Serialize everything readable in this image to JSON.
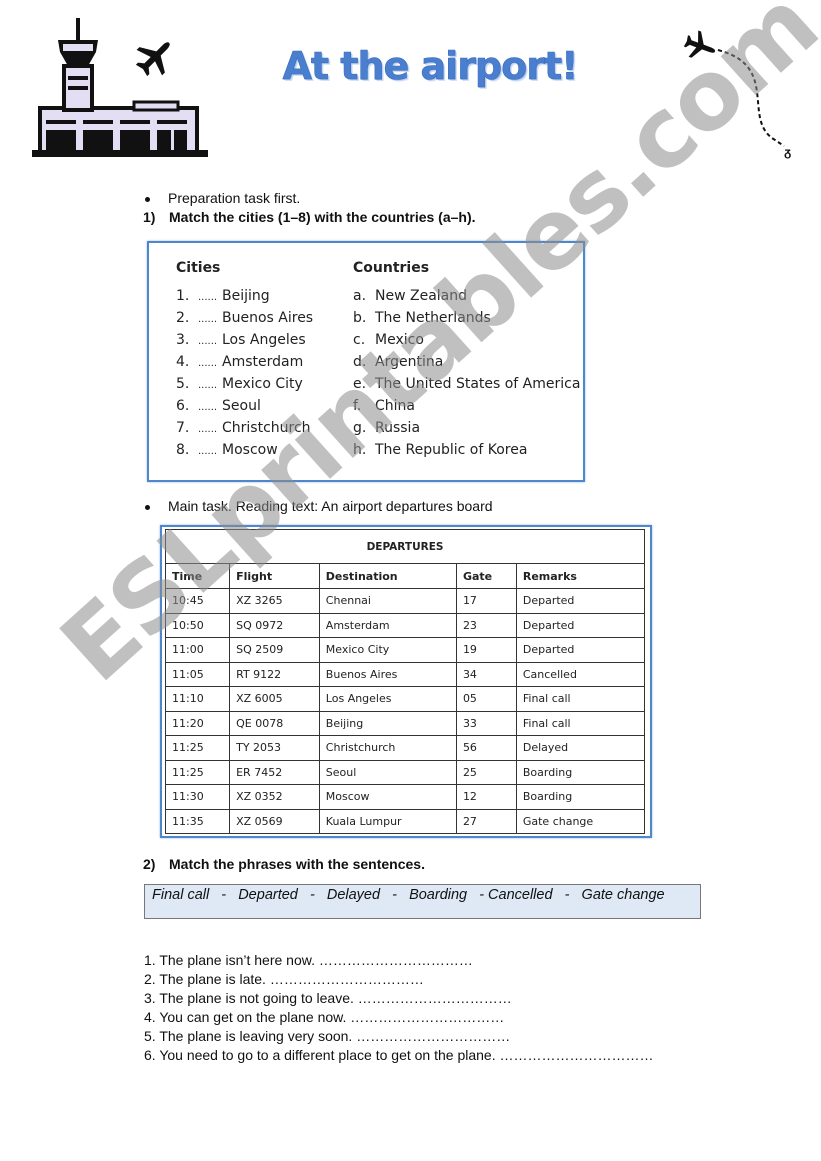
{
  "header": {
    "title": "At the airport!",
    "icons": [
      "airport-building-icon",
      "airplane-icon",
      "flight-path-icon"
    ]
  },
  "prep": {
    "bullet": "Preparation task first.",
    "task_number": "1)",
    "task_text": "Match the cities (1–8) with the countries (a–h)."
  },
  "matching": {
    "cities_heading": "Cities",
    "countries_heading": "Countries",
    "blank": "......",
    "cities": [
      {
        "num": "1.",
        "name": "Beijing"
      },
      {
        "num": "2.",
        "name": "Buenos Aires"
      },
      {
        "num": "3.",
        "name": "Los Angeles"
      },
      {
        "num": "4.",
        "name": "Amsterdam"
      },
      {
        "num": "5.",
        "name": "Mexico City"
      },
      {
        "num": "6.",
        "name": "Seoul"
      },
      {
        "num": "7.",
        "name": "Christchurch"
      },
      {
        "num": "8.",
        "name": "Moscow"
      }
    ],
    "countries": [
      {
        "letter": "a.",
        "name": "New Zealand"
      },
      {
        "letter": "b.",
        "name": "The Netherlands"
      },
      {
        "letter": "c.",
        "name": "Mexico"
      },
      {
        "letter": "d.",
        "name": "Argentina"
      },
      {
        "letter": "e.",
        "name": "The United States of America"
      },
      {
        "letter": "f.",
        "name": "China"
      },
      {
        "letter": "g.",
        "name": "Russia"
      },
      {
        "letter": "h.",
        "name": "The Republic of Korea"
      }
    ]
  },
  "main": {
    "bullet": "Main task. Reading text: An airport departures board"
  },
  "departures": {
    "caption": "DEPARTURES",
    "columns": [
      "Time",
      "Flight",
      "Destination",
      "Gate",
      "Remarks"
    ],
    "rows": [
      [
        "10:45",
        "XZ 3265",
        "Chennai",
        "17",
        "Departed"
      ],
      [
        "10:50",
        "SQ 0972",
        "Amsterdam",
        "23",
        "Departed"
      ],
      [
        "11:00",
        "SQ 2509",
        "Mexico City",
        "19",
        "Departed"
      ],
      [
        "11:05",
        "RT 9122",
        "Buenos Aires",
        "34",
        "Cancelled"
      ],
      [
        "11:10",
        "XZ 6005",
        "Los Angeles",
        "05",
        "Final call"
      ],
      [
        "11:20",
        "QE 0078",
        "Beijing",
        "33",
        "Final call"
      ],
      [
        "11:25",
        "TY 2053",
        "Christchurch",
        "56",
        "Delayed"
      ],
      [
        "11:25",
        "ER 7452",
        "Seoul",
        "25",
        "Boarding"
      ],
      [
        "11:30",
        "XZ 0352",
        "Moscow",
        "12",
        "Boarding"
      ],
      [
        "11:35",
        "XZ 0569",
        "Kuala Lumpur",
        "27",
        "Gate change"
      ]
    ]
  },
  "task2": {
    "task_number": "2)",
    "task_text": "Match the phrases with the sentences.",
    "phrases_line": "Final call   -   Departed   -   Delayed   -   Boarding   - Cancelled   -   Gate change",
    "sentences": [
      "1. The plane isn’t here now. ……………………………",
      "2. The plane is late. ……………………………",
      "3. The plane is not going to leave. ……………………………",
      "4. You can get on the plane now. ……………………………",
      "5. The plane is leaving very soon. ……………………………",
      "6. You need to go to a different place to get on the plane. ……………………………"
    ]
  },
  "watermark": "ESLprintables.com",
  "colors": {
    "title": "#4a7fd0",
    "box_border": "#4f87cc",
    "phrase_box_bg": "#dfe8f5",
    "building_fill": "#e4def5"
  }
}
